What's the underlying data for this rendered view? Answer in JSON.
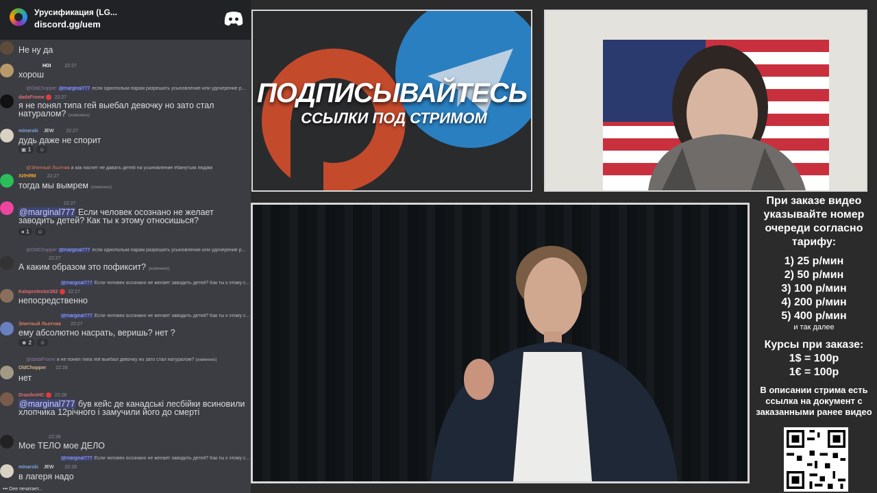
{
  "chat": {
    "server_name": "Урусификация (LG...",
    "invite": "discord.gg/uem",
    "messages": [
      {
        "text": "Не ну да"
      },
      {
        "author": "",
        "badge": "HOI",
        "time": "22:27",
        "text": "хорош"
      },
      {
        "reply_author": "@OldChopper",
        "reply_mention": "@marginal777",
        "reply_text": "если однополым парам разрешить усыновление или удочерение р...",
        "author": "dadaFrome",
        "time": "22:27",
        "text": "я не понял типа гей выебал девочку но зато стал натуралом?",
        "edited": "(изменено)"
      },
      {
        "author": "minarski",
        "badge": "JEW",
        "time": "22:27",
        "text": "дудь даже не спорит",
        "reaction": "1"
      },
      {
        "reply_author": "@Элитный Льотчик",
        "reply_text": "а как насчет не давать детей на усыновление ебанутым людям",
        "author": "ХИНЯМ",
        "time": "22:27",
        "text": "тогда мы вымрем",
        "edited": "(изменено)"
      },
      {
        "time": "22:27",
        "mention": "@marginal777",
        "text": "Если человек осознано не желает заводить детей? Как ты к этому относишься?",
        "reaction": "1"
      },
      {
        "reply_author": "@OldChopper",
        "reply_mention": "@marginal777",
        "reply_text": "если однополым парам разрешить усыновление или удочерение р...",
        "time": "22:27",
        "text": "А каким образом это пофиксит?",
        "edited": "(изменено)"
      },
      {
        "reply_mention": "@marginal777",
        "reply_text": "Если человек осознано не желает заводить детей? Как ты к этому с...",
        "author": "Kaloprotector262",
        "time": "22:27",
        "text": "непосредственно"
      },
      {
        "reply_mention": "@marginal777",
        "reply_text": "Если человек осознано не желает заводить детей? Как ты к этому с...",
        "author": "Элитный Льотчик",
        "time": "22:27",
        "text": "ему абсолютно насрать, веришь? нет ?",
        "reaction": "2"
      },
      {
        "reply_author": "@dadaFrome",
        "reply_text": "я не понял типа гей выебал девочку но зато стал натуралом?",
        "reply_edited": "(изменено)",
        "author": "OldChopper",
        "time": "22:28",
        "text": "нет"
      },
      {
        "author": "DrazdenHC",
        "time": "22:28",
        "mention": "@marginal777",
        "text": "був кейс де канадські лесбійки всиновили хлопчика 12річного і замучили його до смерті"
      },
      {
        "time": "22:28",
        "text": "Мое ТЕЛО мое ДЕЛО"
      },
      {
        "reply_mention": "@marginal777",
        "reply_text": "Если человек осознано не желает заводить детей? Как ты к этому с...",
        "author": "minarski",
        "badge": "JEW",
        "time": "22:28",
        "text": "в лагеря надо"
      }
    ],
    "typing": "Dee печатает..."
  },
  "promo": {
    "title": "ПОДПИСЫВАЙТЕСЬ",
    "subtitle": "ССЫЛКИ ПОД СТРИМОМ"
  },
  "info": {
    "order_text": "При заказе видео указывайте номер очереди согласно тарифу:",
    "rates": [
      "1) 25 р/мин",
      "2) 50 р/мин",
      "3) 100 р/мин",
      "4) 200 р/мин",
      "5) 400 р/мин"
    ],
    "rates_more": "и так далее",
    "courses_title": "Курсы при заказе:",
    "courses": [
      "1$ = 100р",
      "1€ = 100р"
    ],
    "description": "В описании стрима есть ссылка на документ с заказанными ранее видео"
  },
  "colors": {
    "chat_bg": "#3b3d42",
    "chat_header": "#202225",
    "mention": "#c9cdfb",
    "patreon": "#c44a2c",
    "telegram": "#2a7fc0"
  }
}
